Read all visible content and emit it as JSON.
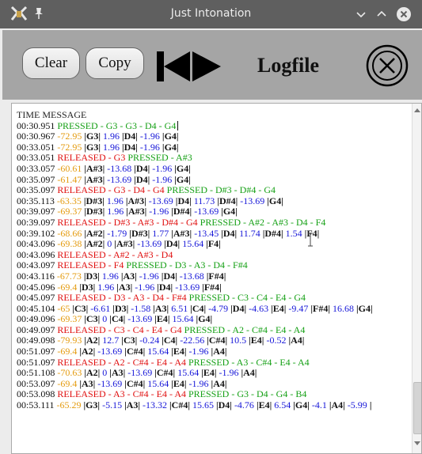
{
  "window": {
    "title": "Just Intonation"
  },
  "toolbar": {
    "clear_label": "Clear",
    "copy_label": "Copy",
    "heading": "Logfile"
  },
  "icons": {
    "app": "app-icon",
    "pin": "pin-icon",
    "minimize": "chevron-down-icon",
    "maximize": "chevron-up-icon",
    "close": "close-icon",
    "prev": "skip-previous-icon",
    "play": "play-icon",
    "close_circle": "close-circle-icon"
  },
  "colors": {
    "green": "#15a015",
    "red": "#e01010",
    "orange": "#e49b0f",
    "blue": "#1717d8",
    "titlebar": "#5f5f5f",
    "toolbar": "#a5a5a5"
  },
  "log": {
    "header": "TIME MESSAGE",
    "rows": [
      [
        [
          "00:30.951 ",
          "black"
        ],
        [
          "PRESSED - G3 - G3 - D4 - G4",
          "green"
        ]
      ],
      [
        [
          "00:30.967 ",
          "black"
        ],
        [
          "-72.95 ",
          "orange"
        ],
        [
          "|G3| ",
          "note"
        ],
        [
          "1.96 ",
          "blue"
        ],
        [
          "|D4| ",
          "note"
        ],
        [
          "-1.96 ",
          "blue"
        ],
        [
          "|G4|",
          "note"
        ]
      ],
      [
        [
          "00:33.051 ",
          "black"
        ],
        [
          "-72.95 ",
          "orange"
        ],
        [
          "|G3| ",
          "note"
        ],
        [
          "1.96 ",
          "blue"
        ],
        [
          "|D4| ",
          "note"
        ],
        [
          "-1.96 ",
          "blue"
        ],
        [
          "|G4|",
          "note"
        ]
      ],
      [
        [
          "00:33.051 ",
          "black"
        ],
        [
          "RELEASED - G3 ",
          "red"
        ],
        [
          "PRESSED - A#3",
          "green"
        ]
      ],
      [
        [
          "00:33.057 ",
          "black"
        ],
        [
          "-60.61 ",
          "orange"
        ],
        [
          "|A#3| ",
          "note"
        ],
        [
          "-13.68 ",
          "blue"
        ],
        [
          "|D4| ",
          "note"
        ],
        [
          "-1.96 ",
          "blue"
        ],
        [
          "|G4|",
          "note"
        ]
      ],
      [
        [
          "00:35.097 ",
          "black"
        ],
        [
          "-61.47 ",
          "orange"
        ],
        [
          "|A#3| ",
          "note"
        ],
        [
          "-13.69 ",
          "blue"
        ],
        [
          "|D4| ",
          "note"
        ],
        [
          "-1.96 ",
          "blue"
        ],
        [
          "|G4|",
          "note"
        ]
      ],
      [
        [
          "00:35.097 ",
          "black"
        ],
        [
          "RELEASED - G3 - D4 - G4 ",
          "red"
        ],
        [
          "PRESSED - D#3 - D#4 - G4",
          "green"
        ]
      ],
      [
        [
          "00:35.113 ",
          "black"
        ],
        [
          "-63.35 ",
          "orange"
        ],
        [
          "|D#3| ",
          "note"
        ],
        [
          "1.96 ",
          "blue"
        ],
        [
          "|A#3| ",
          "note"
        ],
        [
          "-13.69 ",
          "blue"
        ],
        [
          "|D4| ",
          "note"
        ],
        [
          "11.73 ",
          "blue"
        ],
        [
          "|D#4| ",
          "note"
        ],
        [
          "-13.69 ",
          "blue"
        ],
        [
          "|G4|",
          "note"
        ]
      ],
      [
        [
          "00:39.097 ",
          "black"
        ],
        [
          "-69.37 ",
          "orange"
        ],
        [
          "|D#3| ",
          "note"
        ],
        [
          "1.96 ",
          "blue"
        ],
        [
          "|A#3| ",
          "note"
        ],
        [
          "-1.96 ",
          "blue"
        ],
        [
          "|D#4| ",
          "note"
        ],
        [
          "-13.69 ",
          "blue"
        ],
        [
          "|G4|",
          "note"
        ]
      ],
      [
        [
          "00:39.097 ",
          "black"
        ],
        [
          "RELEASED - D#3 - A#3 - D#4 - G4 ",
          "red"
        ],
        [
          "PRESSED - A#2 - A#3 - D4 - F4",
          "green"
        ]
      ],
      [
        [
          "00:39.102 ",
          "black"
        ],
        [
          "-68.66 ",
          "orange"
        ],
        [
          "|A#2| ",
          "note"
        ],
        [
          "-1.79 ",
          "blue"
        ],
        [
          "|D#3| ",
          "note"
        ],
        [
          "1.77 ",
          "blue"
        ],
        [
          "|A#3| ",
          "note"
        ],
        [
          "-13.45 ",
          "blue"
        ],
        [
          "|D4| ",
          "note"
        ],
        [
          "11.74 ",
          "blue"
        ],
        [
          "|D#4| ",
          "note"
        ],
        [
          "1.54 ",
          "blue"
        ],
        [
          "|F4|",
          "note"
        ]
      ],
      [
        [
          "00:43.096 ",
          "black"
        ],
        [
          "-69.38 ",
          "orange"
        ],
        [
          "|A#2| ",
          "note"
        ],
        [
          "0 ",
          "blue"
        ],
        [
          "|A#3| ",
          "note"
        ],
        [
          "-13.69 ",
          "blue"
        ],
        [
          "|D4| ",
          "note"
        ],
        [
          "15.64 ",
          "blue"
        ],
        [
          "|F4|",
          "note"
        ]
      ],
      [
        [
          "00:43.096 ",
          "black"
        ],
        [
          "RELEASED - A#2 - A#3 - D4",
          "red"
        ]
      ],
      [
        [
          "00:43.097 ",
          "black"
        ],
        [
          "RELEASED - F4 ",
          "red"
        ],
        [
          "PRESSED - D3 - A3 - D4 - F#4",
          "green"
        ]
      ],
      [
        [
          "00:43.116 ",
          "black"
        ],
        [
          "-67.73 ",
          "orange"
        ],
        [
          "|D3| ",
          "note"
        ],
        [
          "1.96 ",
          "blue"
        ],
        [
          "|A3| ",
          "note"
        ],
        [
          "-1.96 ",
          "blue"
        ],
        [
          "|D4| ",
          "note"
        ],
        [
          "-13.68 ",
          "blue"
        ],
        [
          "|F#4|",
          "note"
        ]
      ],
      [
        [
          "00:45.096 ",
          "black"
        ],
        [
          "-69.4 ",
          "orange"
        ],
        [
          "|D3| ",
          "note"
        ],
        [
          "1.96 ",
          "blue"
        ],
        [
          "|A3| ",
          "note"
        ],
        [
          "-1.96 ",
          "blue"
        ],
        [
          "|D4| ",
          "note"
        ],
        [
          "-13.69 ",
          "blue"
        ],
        [
          "|F#4|",
          "note"
        ]
      ],
      [
        [
          "00:45.097 ",
          "black"
        ],
        [
          "RELEASED - D3 - A3 - D4 - F#4 ",
          "red"
        ],
        [
          "PRESSED - C3 - C4 - E4 - G4",
          "green"
        ]
      ],
      [
        [
          "00:45.104 ",
          "black"
        ],
        [
          "-65 ",
          "orange"
        ],
        [
          "|C3| ",
          "note"
        ],
        [
          "-6.61 ",
          "blue"
        ],
        [
          "|D3| ",
          "note"
        ],
        [
          "-1.58 ",
          "blue"
        ],
        [
          "|A3| ",
          "note"
        ],
        [
          "6.51 ",
          "blue"
        ],
        [
          "|C4| ",
          "note"
        ],
        [
          "-4.79 ",
          "blue"
        ],
        [
          "|D4| ",
          "note"
        ],
        [
          "-4.63 ",
          "blue"
        ],
        [
          "|E4| ",
          "note"
        ],
        [
          "-9.47 ",
          "blue"
        ],
        [
          "|F#4| ",
          "note"
        ],
        [
          "16.68 ",
          "blue"
        ],
        [
          "|G4|",
          "note"
        ]
      ],
      [
        [
          "00:49.096 ",
          "black"
        ],
        [
          "-69.37 ",
          "orange"
        ],
        [
          "|C3| ",
          "note"
        ],
        [
          "0 ",
          "blue"
        ],
        [
          "|C4| ",
          "note"
        ],
        [
          "-13.69 ",
          "blue"
        ],
        [
          "|E4| ",
          "note"
        ],
        [
          "15.64 ",
          "blue"
        ],
        [
          "|G4|",
          "note"
        ]
      ],
      [
        [
          "00:49.097 ",
          "black"
        ],
        [
          "RELEASED - C3 - C4 - E4 - G4 ",
          "red"
        ],
        [
          "PRESSED - A2 - C#4 - E4 - A4",
          "green"
        ]
      ],
      [
        [
          "00:49.098 ",
          "black"
        ],
        [
          "-79.93 ",
          "orange"
        ],
        [
          "|A2| ",
          "note"
        ],
        [
          "12.7 ",
          "blue"
        ],
        [
          "|C3| ",
          "note"
        ],
        [
          "-0.24 ",
          "blue"
        ],
        [
          "|C4| ",
          "note"
        ],
        [
          "-22.56 ",
          "blue"
        ],
        [
          "|C#4| ",
          "note"
        ],
        [
          "10.5 ",
          "blue"
        ],
        [
          "|E4| ",
          "note"
        ],
        [
          "-0.52 ",
          "blue"
        ],
        [
          "|A4|",
          "note"
        ]
      ],
      [
        [
          "00:51.097 ",
          "black"
        ],
        [
          "-69.4 ",
          "orange"
        ],
        [
          "|A2| ",
          "note"
        ],
        [
          "-13.69 ",
          "blue"
        ],
        [
          "|C#4| ",
          "note"
        ],
        [
          "15.64 ",
          "blue"
        ],
        [
          "|E4| ",
          "note"
        ],
        [
          "-1.96 ",
          "blue"
        ],
        [
          "|A4|",
          "note"
        ]
      ],
      [
        [
          "00:51.097 ",
          "black"
        ],
        [
          "RELEASED - A2 - C#4 - E4 - A4 ",
          "red"
        ],
        [
          "PRESSED - A3 - C#4 - E4 - A4",
          "green"
        ]
      ],
      [
        [
          "00:51.108 ",
          "black"
        ],
        [
          "-70.63 ",
          "orange"
        ],
        [
          "|A2| ",
          "note"
        ],
        [
          "0 ",
          "blue"
        ],
        [
          "|A3| ",
          "note"
        ],
        [
          "-13.69 ",
          "blue"
        ],
        [
          "|C#4| ",
          "note"
        ],
        [
          "15.64 ",
          "blue"
        ],
        [
          "|E4| ",
          "note"
        ],
        [
          "-1.96 ",
          "blue"
        ],
        [
          "|A4|",
          "note"
        ]
      ],
      [
        [
          "00:53.097 ",
          "black"
        ],
        [
          "-69.4 ",
          "orange"
        ],
        [
          "|A3| ",
          "note"
        ],
        [
          "-13.69 ",
          "blue"
        ],
        [
          "|C#4| ",
          "note"
        ],
        [
          "15.64 ",
          "blue"
        ],
        [
          "|E4| ",
          "note"
        ],
        [
          "-1.96 ",
          "blue"
        ],
        [
          "|A4|",
          "note"
        ]
      ],
      [
        [
          "00:53.098 ",
          "black"
        ],
        [
          "RELEASED - A3 - C#4 - E4 - A4 ",
          "red"
        ],
        [
          "PRESSED - G3 - D4 - G4 - B4",
          "green"
        ]
      ],
      [
        [
          "00:53.111 ",
          "black"
        ],
        [
          "-65.29 ",
          "orange"
        ],
        [
          "|G3| ",
          "note"
        ],
        [
          "-5.15 ",
          "blue"
        ],
        [
          "|A3| ",
          "note"
        ],
        [
          "-13.32 ",
          "blue"
        ],
        [
          "|C#4| ",
          "note"
        ],
        [
          "15.65 ",
          "blue"
        ],
        [
          "|D4| ",
          "note"
        ],
        [
          "-4.76 ",
          "blue"
        ],
        [
          "|E4| ",
          "note"
        ],
        [
          "6.54 ",
          "blue"
        ],
        [
          "|G4| ",
          "note"
        ],
        [
          "-4.1 ",
          "blue"
        ],
        [
          "|A4| ",
          "note"
        ],
        [
          "-5.99 ",
          "blue"
        ],
        [
          "|",
          "note"
        ]
      ]
    ]
  }
}
